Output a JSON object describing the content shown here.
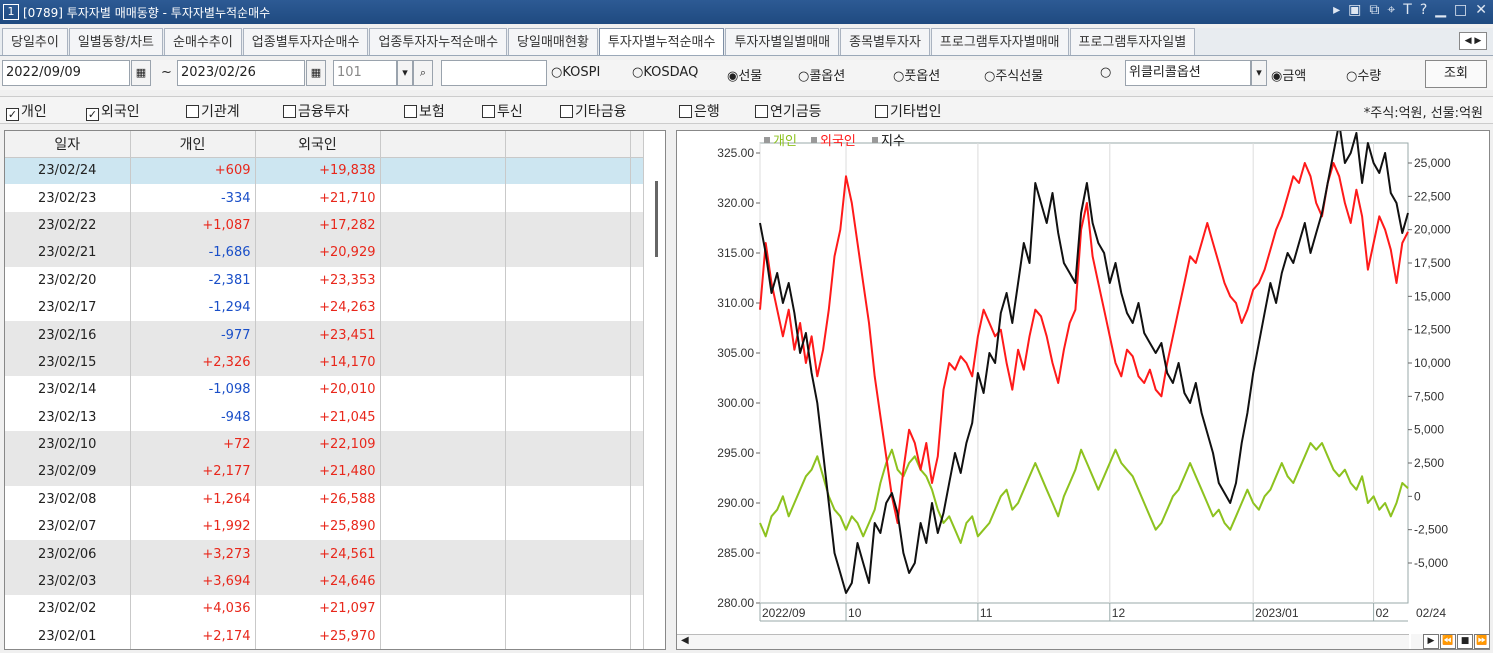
{
  "window": {
    "number": "1",
    "title": "[0789] 투자자별 매매동향 - 투자자별누적순매수"
  },
  "tabs": [
    {
      "label": "당일추이"
    },
    {
      "label": "일별동향/차트"
    },
    {
      "label": "순매수추이"
    },
    {
      "label": "업종별투자자순매수"
    },
    {
      "label": "업종투자자누적순매수"
    },
    {
      "label": "당일매매현황"
    },
    {
      "label": "투자자별누적순매수",
      "active": true
    },
    {
      "label": "투자자별일별매매"
    },
    {
      "label": "종목별투자자"
    },
    {
      "label": "프로그램투자자별매매"
    },
    {
      "label": "프로그램투자자일별"
    }
  ],
  "toolbar": {
    "date_from": "2022/09/09",
    "range_sep": "~",
    "date_to": "2023/02/26",
    "code": "101",
    "search_value": "",
    "market_options": [
      "KOSPI",
      "KOSDAQ",
      "선물",
      "콜옵션",
      "풋옵션",
      "주식선물"
    ],
    "market_selected": "선물",
    "weekly_option_label": "위클리콜옵션",
    "unit_options": [
      "금액",
      "수량"
    ],
    "unit_selected": "금액",
    "query_label": "조회"
  },
  "checks": [
    {
      "label": "개인",
      "checked": true
    },
    {
      "label": "외국인",
      "checked": true
    },
    {
      "label": "기관계",
      "checked": false
    },
    {
      "label": "금융투자",
      "checked": false
    },
    {
      "label": "보험",
      "checked": false
    },
    {
      "label": "투신",
      "checked": false
    },
    {
      "label": "기타금융",
      "checked": false
    },
    {
      "label": "은행",
      "checked": false
    },
    {
      "label": "연기금등",
      "checked": false
    },
    {
      "label": "기타법인",
      "checked": false
    }
  ],
  "unit_note": "*주식:억원, 선물:억원",
  "grid": {
    "headers": [
      "일자",
      "개인",
      "외국인",
      "",
      "",
      ""
    ],
    "rows": [
      {
        "date": "23/02/24",
        "individual": "+609",
        "foreign": "+19,838"
      },
      {
        "date": "23/02/23",
        "individual": "-334",
        "foreign": "+21,710"
      },
      {
        "date": "23/02/22",
        "individual": "+1,087",
        "foreign": "+17,282"
      },
      {
        "date": "23/02/21",
        "individual": "-1,686",
        "foreign": "+20,929"
      },
      {
        "date": "23/02/20",
        "individual": "-2,381",
        "foreign": "+23,353"
      },
      {
        "date": "23/02/17",
        "individual": "-1,294",
        "foreign": "+24,263"
      },
      {
        "date": "23/02/16",
        "individual": "-977",
        "foreign": "+23,451"
      },
      {
        "date": "23/02/15",
        "individual": "+2,326",
        "foreign": "+14,170"
      },
      {
        "date": "23/02/14",
        "individual": "-1,098",
        "foreign": "+20,010"
      },
      {
        "date": "23/02/13",
        "individual": "-948",
        "foreign": "+21,045"
      },
      {
        "date": "23/02/10",
        "individual": "+72",
        "foreign": "+22,109"
      },
      {
        "date": "23/02/09",
        "individual": "+2,177",
        "foreign": "+21,480"
      },
      {
        "date": "23/02/08",
        "individual": "+1,264",
        "foreign": "+26,588"
      },
      {
        "date": "23/02/07",
        "individual": "+1,992",
        "foreign": "+25,890"
      },
      {
        "date": "23/02/06",
        "individual": "+3,273",
        "foreign": "+24,561"
      },
      {
        "date": "23/02/03",
        "individual": "+3,694",
        "foreign": "+24,646"
      },
      {
        "date": "23/02/02",
        "individual": "+4,036",
        "foreign": "+21,097"
      },
      {
        "date": "23/02/01",
        "individual": "+2,174",
        "foreign": "+25,970"
      }
    ]
  },
  "chart_data": {
    "type": "line",
    "legend": [
      "개인",
      "외국인",
      "지수"
    ],
    "series_colors": {
      "individual": "#8dc21f",
      "foreign": "#ff1a1a",
      "index": "#111111"
    },
    "left_axis": {
      "ticks": [
        "325.00",
        "320.00",
        "315.00",
        "310.00",
        "305.00",
        "300.00",
        "295.00",
        "290.00",
        "285.00",
        "280.00"
      ],
      "ylim": [
        280,
        326
      ]
    },
    "right_axis": {
      "ticks": [
        "25,000",
        "22,500",
        "20,000",
        "17,500",
        "15,000",
        "12,500",
        "10,000",
        "7,500",
        "5,000",
        "2,500",
        "0",
        "-2,500",
        "-5,000"
      ],
      "ylim": [
        -8000,
        26500
      ]
    },
    "x_labels": [
      "2022/09",
      "10",
      "11",
      "12",
      "2023/01",
      "02"
    ],
    "x_last_label": "02/24",
    "n_points": 114,
    "label_positions": [
      0,
      15,
      38,
      61,
      86,
      107
    ],
    "index_values": [
      318,
      315,
      311,
      313,
      310,
      312,
      309,
      305,
      307,
      303,
      300,
      295,
      290,
      285,
      283,
      281,
      282,
      286,
      284,
      282,
      288,
      287,
      290,
      291,
      289,
      285,
      283,
      284,
      288,
      286,
      290,
      287,
      289,
      292,
      295,
      293,
      296,
      298,
      303,
      301,
      305,
      304,
      309,
      311,
      308,
      312,
      316,
      314,
      322,
      320,
      318,
      321,
      317,
      314,
      313,
      312,
      319,
      322,
      318,
      316,
      315,
      312,
      314,
      311,
      309,
      308,
      310,
      307,
      306,
      305,
      306,
      303,
      302,
      304,
      301,
      300,
      302,
      299,
      297,
      295,
      292,
      291,
      290,
      292,
      296,
      299,
      303,
      306,
      309,
      312,
      310,
      313,
      315,
      314,
      316,
      318,
      315,
      317,
      319,
      322,
      325,
      328,
      324,
      325,
      327,
      322,
      326,
      324,
      323,
      325,
      321,
      320,
      317,
      319
    ],
    "individual_values": [
      -2000,
      -3000,
      -1500,
      -1000,
      0,
      -1500,
      -500,
      500,
      1500,
      2000,
      3000,
      1500,
      0,
      -1000,
      -1500,
      -2500,
      -1500,
      -2000,
      -3000,
      -2000,
      -1000,
      1000,
      2500,
      3500,
      2000,
      1500,
      2500,
      3000,
      2000,
      1500,
      500,
      -1000,
      -2000,
      -1500,
      -2500,
      -3500,
      -2000,
      -1500,
      -3000,
      -2500,
      -2000,
      -1000,
      0,
      500,
      -1000,
      -500,
      500,
      1500,
      2500,
      1500,
      500,
      -500,
      -1500,
      0,
      1000,
      2000,
      3500,
      2500,
      1500,
      500,
      1500,
      2500,
      3500,
      2500,
      2000,
      1500,
      500,
      -500,
      -1500,
      -2500,
      -2000,
      -1000,
      0,
      500,
      1500,
      2500,
      1500,
      500,
      -500,
      -1500,
      -1000,
      -2000,
      -2500,
      -1500,
      -500,
      500,
      -500,
      -1000,
      0,
      500,
      1500,
      2500,
      1500,
      1000,
      2000,
      3000,
      4000,
      3500,
      4000,
      3000,
      2000,
      1500,
      2000,
      1000,
      500,
      1500,
      -500,
      0,
      -1000,
      -500,
      -1500,
      -500,
      1000,
      609
    ],
    "foreign_values": [
      14000,
      19000,
      16000,
      14000,
      12000,
      14000,
      11000,
      13000,
      10000,
      12000,
      9000,
      11000,
      14000,
      18000,
      20000,
      24000,
      22000,
      19000,
      16000,
      13000,
      9000,
      6000,
      3000,
      0,
      -2000,
      2000,
      5000,
      4000,
      2000,
      4000,
      1000,
      3000,
      8000,
      10000,
      9500,
      10500,
      10000,
      9000,
      12000,
      14000,
      13000,
      12000,
      12500,
      10000,
      8000,
      11000,
      9500,
      12000,
      14000,
      13500,
      12000,
      10000,
      8500,
      11000,
      13000,
      14000,
      20000,
      22000,
      18000,
      16000,
      14000,
      12000,
      10000,
      9000,
      11000,
      10500,
      9000,
      8500,
      9500,
      8000,
      7500,
      10000,
      12000,
      14000,
      16000,
      18000,
      17500,
      19000,
      20500,
      19000,
      17500,
      16000,
      15000,
      14500,
      13000,
      14000,
      15500,
      16000,
      17000,
      18500,
      20000,
      21000,
      22500,
      24000,
      23500,
      25000,
      24000,
      22000,
      21000,
      23500,
      25000,
      24000,
      22000,
      20500,
      23000,
      21000,
      17000,
      19000,
      21000,
      20000,
      18500,
      16000,
      19000,
      19838
    ]
  }
}
